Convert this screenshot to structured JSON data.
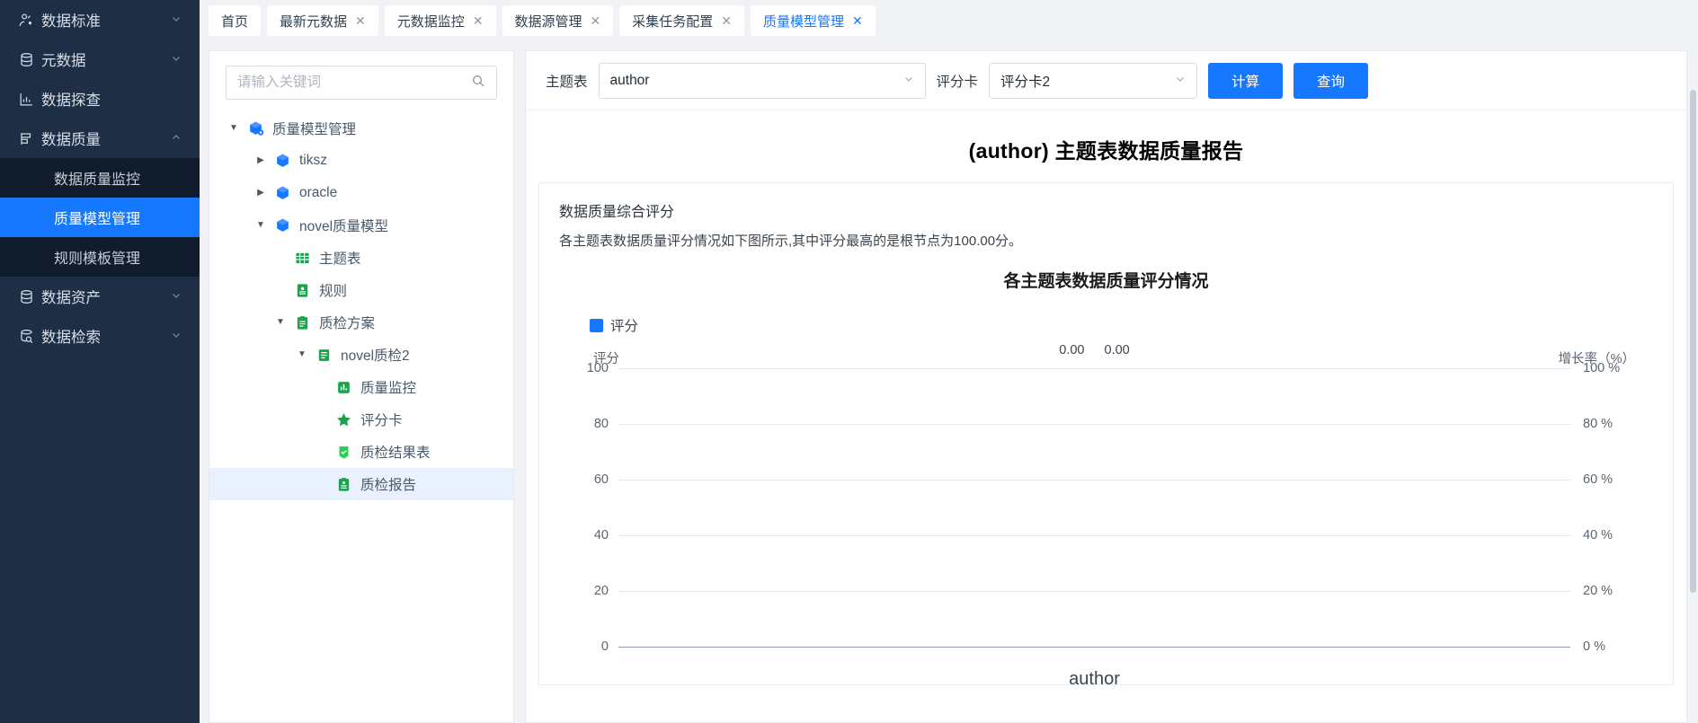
{
  "sidebar": {
    "items": [
      {
        "label": "数据标准",
        "icon": "standard-icon",
        "chevron": "chevron-down-icon",
        "expanded": false
      },
      {
        "label": "元数据",
        "icon": "database-icon",
        "chevron": "chevron-down-icon",
        "expanded": false
      },
      {
        "label": "数据探查",
        "icon": "chart-icon",
        "chevron": "",
        "expanded": false
      },
      {
        "label": "数据质量",
        "icon": "quality-icon",
        "chevron": "chevron-up-icon",
        "expanded": true
      },
      {
        "label": "数据资产",
        "icon": "database-icon",
        "chevron": "chevron-down-icon",
        "expanded": false
      },
      {
        "label": "数据检索",
        "icon": "search-db-icon",
        "chevron": "chevron-down-icon",
        "expanded": false
      }
    ],
    "subitems": [
      {
        "label": "数据质量监控",
        "active": false
      },
      {
        "label": "质量模型管理",
        "active": true
      },
      {
        "label": "规则模板管理",
        "active": false
      }
    ],
    "active_color": "#1677ff"
  },
  "tabs": [
    {
      "label": "首页",
      "closable": false,
      "active": false
    },
    {
      "label": "最新元数据",
      "closable": true,
      "active": false
    },
    {
      "label": "元数据监控",
      "closable": true,
      "active": false
    },
    {
      "label": "数据源管理",
      "closable": true,
      "active": false
    },
    {
      "label": "采集任务配置",
      "closable": true,
      "active": false
    },
    {
      "label": "质量模型管理",
      "closable": true,
      "active": true
    }
  ],
  "tab_close_glyph": "✕",
  "tree_panel": {
    "search_placeholder": "请输入关键词",
    "search_value": "",
    "search_icon": "search-icon",
    "nodes": [
      {
        "label": "质量模型管理",
        "indent": 0,
        "arrow": "down",
        "icon": "model-root-icon",
        "icon_color": "#1677ff",
        "selected": false
      },
      {
        "label": "tiksz",
        "indent": 1,
        "arrow": "right",
        "icon": "cube-icon",
        "icon_color": "#1677ff",
        "selected": false
      },
      {
        "label": "oracle",
        "indent": 1,
        "arrow": "right",
        "icon": "cube-icon",
        "icon_color": "#1677ff",
        "selected": false
      },
      {
        "label": "novel质量模型",
        "indent": 1,
        "arrow": "down",
        "icon": "cube-icon",
        "icon_color": "#1677ff",
        "selected": false
      },
      {
        "label": "主题表",
        "indent": 2,
        "arrow": "",
        "icon": "table-icon",
        "icon_color": "#17a74a",
        "selected": false
      },
      {
        "label": "规则",
        "indent": 2,
        "arrow": "",
        "icon": "rule-icon",
        "icon_color": "#17a74a",
        "selected": false
      },
      {
        "label": "质检方案",
        "indent": 2,
        "arrow": "down",
        "icon": "plan-icon",
        "icon_color": "#17a74a",
        "selected": false
      },
      {
        "label": "novel质检2",
        "indent": 3,
        "arrow": "down",
        "icon": "doc-icon",
        "icon_color": "#17a74a",
        "selected": false
      },
      {
        "label": "质量监控",
        "indent": 4,
        "arrow": "",
        "icon": "monitor-chart-icon",
        "icon_color": "#17a74a",
        "selected": false
      },
      {
        "label": "评分卡",
        "indent": 4,
        "arrow": "",
        "icon": "star-icon",
        "icon_color": "#17a74a",
        "selected": false
      },
      {
        "label": "质检结果表",
        "indent": 4,
        "arrow": "",
        "icon": "check-result-icon",
        "icon_color": "#2ecc57",
        "selected": false
      },
      {
        "label": "质检报告",
        "indent": 4,
        "arrow": "",
        "icon": "report-icon",
        "icon_color": "#17a74a",
        "selected": true
      }
    ]
  },
  "toolbar": {
    "subject_label": "主题表",
    "subject_value": "author",
    "card_label": "评分卡",
    "card_value": "评分卡2",
    "calc_button": "计算",
    "query_button": "查询",
    "dropdown_icon": "chevron-down-icon",
    "button_color": "#1677ff"
  },
  "report": {
    "title": "(author) 主题表数据质量报告",
    "section_heading": "数据质量综合评分",
    "section_text": "各主题表数据质量评分情况如下图所示,其中评分最高的是根节点为100.00分。"
  },
  "chart_data": {
    "type": "bar",
    "title": "各主题表数据质量评分情况",
    "categories": [
      "author"
    ],
    "series": [
      {
        "name": "评分",
        "values": [
          0.0
        ],
        "color": "#1677ff"
      }
    ],
    "data_labels": [
      "0.00",
      "0.00"
    ],
    "legend": [
      "评分"
    ],
    "legend_position": "top-left",
    "ylabel": "评分",
    "ylim": [
      0,
      100
    ],
    "yticks": [
      100,
      80,
      60,
      40,
      20,
      0
    ],
    "y2label": "增长率（%）",
    "y2lim": [
      0,
      100
    ],
    "y2ticks": [
      "100 %",
      "80 %",
      "60 %",
      "40 %",
      "20 %",
      "0 %"
    ],
    "xlabel": "author",
    "grid": true
  }
}
